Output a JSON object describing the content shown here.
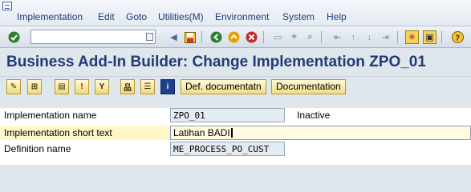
{
  "menu": {
    "items": [
      {
        "label": "Implementation"
      },
      {
        "label": "Edit"
      },
      {
        "label": "Goto"
      },
      {
        "label": "Utilities(M)"
      },
      {
        "label": "Environment"
      },
      {
        "label": "System"
      },
      {
        "label": "Help"
      }
    ]
  },
  "toolbar": {
    "command_value": "",
    "icons": [
      "enter-icon",
      "save-icon",
      "back-icon",
      "exit-icon",
      "cancel-icon",
      "print-icon",
      "find-icon",
      "find-next-icon",
      "first-page-icon",
      "previous-page-icon",
      "next-page-icon",
      "last-page-icon",
      "create-session-icon",
      "shortcut-icon",
      "help-icon"
    ]
  },
  "title": "Business Add-In Builder: Change Implementation ZPO_01",
  "app_toolbar": {
    "def_doc_label": "Def. documentatn",
    "documentation_label": "Documentation"
  },
  "form": {
    "implementation_name": {
      "label": "Implementation name",
      "value": "ZPO_01",
      "status": "Inactive"
    },
    "short_text": {
      "label": "Implementation short text",
      "value": "Latihan BADI"
    },
    "definition_name": {
      "label": "Definition name",
      "value": "ME_PROCESS_PO_CUST"
    }
  },
  "colors": {
    "title": "#1f3c76",
    "menu_text": "#1c3d7a",
    "background": "#dfe6ec",
    "button_yellow": "#f1dc86"
  }
}
